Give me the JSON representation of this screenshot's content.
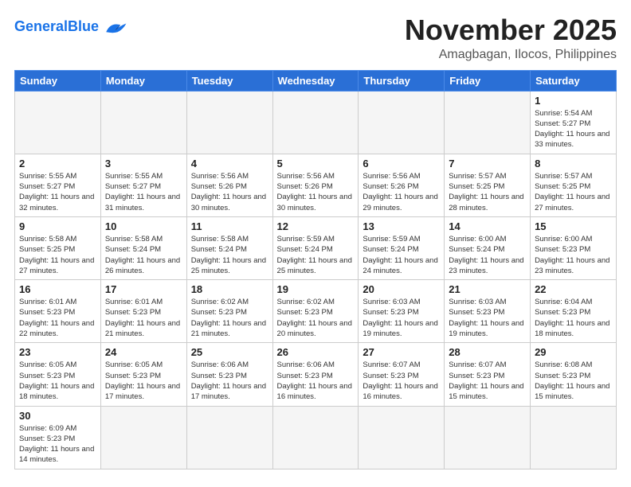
{
  "header": {
    "logo_general": "General",
    "logo_blue": "Blue",
    "month_title": "November 2025",
    "location": "Amagbagan, Ilocos, Philippines"
  },
  "days_of_week": [
    "Sunday",
    "Monday",
    "Tuesday",
    "Wednesday",
    "Thursday",
    "Friday",
    "Saturday"
  ],
  "weeks": [
    [
      {
        "day": "",
        "info": ""
      },
      {
        "day": "",
        "info": ""
      },
      {
        "day": "",
        "info": ""
      },
      {
        "day": "",
        "info": ""
      },
      {
        "day": "",
        "info": ""
      },
      {
        "day": "",
        "info": ""
      },
      {
        "day": "1",
        "info": "Sunrise: 5:54 AM\nSunset: 5:27 PM\nDaylight: 11 hours\nand 33 minutes."
      }
    ],
    [
      {
        "day": "2",
        "info": "Sunrise: 5:55 AM\nSunset: 5:27 PM\nDaylight: 11 hours\nand 32 minutes."
      },
      {
        "day": "3",
        "info": "Sunrise: 5:55 AM\nSunset: 5:27 PM\nDaylight: 11 hours\nand 31 minutes."
      },
      {
        "day": "4",
        "info": "Sunrise: 5:56 AM\nSunset: 5:26 PM\nDaylight: 11 hours\nand 30 minutes."
      },
      {
        "day": "5",
        "info": "Sunrise: 5:56 AM\nSunset: 5:26 PM\nDaylight: 11 hours\nand 30 minutes."
      },
      {
        "day": "6",
        "info": "Sunrise: 5:56 AM\nSunset: 5:26 PM\nDaylight: 11 hours\nand 29 minutes."
      },
      {
        "day": "7",
        "info": "Sunrise: 5:57 AM\nSunset: 5:25 PM\nDaylight: 11 hours\nand 28 minutes."
      },
      {
        "day": "8",
        "info": "Sunrise: 5:57 AM\nSunset: 5:25 PM\nDaylight: 11 hours\nand 27 minutes."
      }
    ],
    [
      {
        "day": "9",
        "info": "Sunrise: 5:58 AM\nSunset: 5:25 PM\nDaylight: 11 hours\nand 27 minutes."
      },
      {
        "day": "10",
        "info": "Sunrise: 5:58 AM\nSunset: 5:24 PM\nDaylight: 11 hours\nand 26 minutes."
      },
      {
        "day": "11",
        "info": "Sunrise: 5:58 AM\nSunset: 5:24 PM\nDaylight: 11 hours\nand 25 minutes."
      },
      {
        "day": "12",
        "info": "Sunrise: 5:59 AM\nSunset: 5:24 PM\nDaylight: 11 hours\nand 25 minutes."
      },
      {
        "day": "13",
        "info": "Sunrise: 5:59 AM\nSunset: 5:24 PM\nDaylight: 11 hours\nand 24 minutes."
      },
      {
        "day": "14",
        "info": "Sunrise: 6:00 AM\nSunset: 5:24 PM\nDaylight: 11 hours\nand 23 minutes."
      },
      {
        "day": "15",
        "info": "Sunrise: 6:00 AM\nSunset: 5:23 PM\nDaylight: 11 hours\nand 23 minutes."
      }
    ],
    [
      {
        "day": "16",
        "info": "Sunrise: 6:01 AM\nSunset: 5:23 PM\nDaylight: 11 hours\nand 22 minutes."
      },
      {
        "day": "17",
        "info": "Sunrise: 6:01 AM\nSunset: 5:23 PM\nDaylight: 11 hours\nand 21 minutes."
      },
      {
        "day": "18",
        "info": "Sunrise: 6:02 AM\nSunset: 5:23 PM\nDaylight: 11 hours\nand 21 minutes."
      },
      {
        "day": "19",
        "info": "Sunrise: 6:02 AM\nSunset: 5:23 PM\nDaylight: 11 hours\nand 20 minutes."
      },
      {
        "day": "20",
        "info": "Sunrise: 6:03 AM\nSunset: 5:23 PM\nDaylight: 11 hours\nand 19 minutes."
      },
      {
        "day": "21",
        "info": "Sunrise: 6:03 AM\nSunset: 5:23 PM\nDaylight: 11 hours\nand 19 minutes."
      },
      {
        "day": "22",
        "info": "Sunrise: 6:04 AM\nSunset: 5:23 PM\nDaylight: 11 hours\nand 18 minutes."
      }
    ],
    [
      {
        "day": "23",
        "info": "Sunrise: 6:05 AM\nSunset: 5:23 PM\nDaylight: 11 hours\nand 18 minutes."
      },
      {
        "day": "24",
        "info": "Sunrise: 6:05 AM\nSunset: 5:23 PM\nDaylight: 11 hours\nand 17 minutes."
      },
      {
        "day": "25",
        "info": "Sunrise: 6:06 AM\nSunset: 5:23 PM\nDaylight: 11 hours\nand 17 minutes."
      },
      {
        "day": "26",
        "info": "Sunrise: 6:06 AM\nSunset: 5:23 PM\nDaylight: 11 hours\nand 16 minutes."
      },
      {
        "day": "27",
        "info": "Sunrise: 6:07 AM\nSunset: 5:23 PM\nDaylight: 11 hours\nand 16 minutes."
      },
      {
        "day": "28",
        "info": "Sunrise: 6:07 AM\nSunset: 5:23 PM\nDaylight: 11 hours\nand 15 minutes."
      },
      {
        "day": "29",
        "info": "Sunrise: 6:08 AM\nSunset: 5:23 PM\nDaylight: 11 hours\nand 15 minutes."
      }
    ],
    [
      {
        "day": "30",
        "info": "Sunrise: 6:09 AM\nSunset: 5:23 PM\nDaylight: 11 hours\nand 14 minutes."
      },
      {
        "day": "",
        "info": ""
      },
      {
        "day": "",
        "info": ""
      },
      {
        "day": "",
        "info": ""
      },
      {
        "day": "",
        "info": ""
      },
      {
        "day": "",
        "info": ""
      },
      {
        "day": "",
        "info": ""
      }
    ]
  ]
}
